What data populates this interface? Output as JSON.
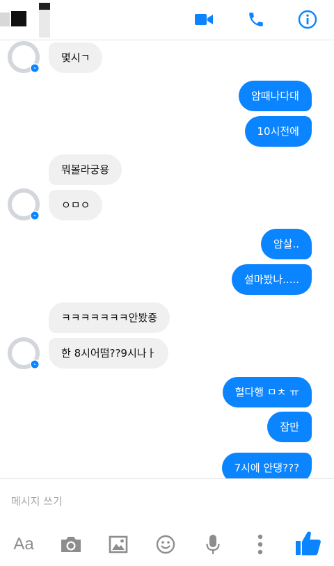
{
  "messages": [
    {
      "dir": "in",
      "text": "몇시ㄱ"
    },
    {
      "dir": "out",
      "text": "암때나다대"
    },
    {
      "dir": "out",
      "text": "10시전에"
    },
    {
      "dir": "in",
      "text": "뭐볼라궁용"
    },
    {
      "dir": "in",
      "text": "ㅇㅁㅇ"
    },
    {
      "dir": "out",
      "text": "암살.."
    },
    {
      "dir": "out",
      "text": "설마봤나....."
    },
    {
      "dir": "in",
      "text": "ㅋㅋㅋㅋㅋㅋㅋ안봤죵"
    },
    {
      "dir": "in",
      "text": "한 8시어떰??9시나ㅏ"
    },
    {
      "dir": "out",
      "text": "헐다행 ㅁㅊ ㅠ"
    },
    {
      "dir": "out",
      "text": "잠만"
    },
    {
      "dir": "out",
      "text": "7시에 안댕???"
    }
  ],
  "composer": {
    "placeholder": "메시지 쓰기",
    "font_button_label": "Aa"
  },
  "icons": {
    "header": [
      "video-camera-icon",
      "phone-icon",
      "info-icon"
    ],
    "toolbar": [
      "font-icon",
      "camera-icon",
      "gallery-icon",
      "emoji-icon",
      "microphone-icon",
      "more-icon",
      "like-icon"
    ]
  },
  "colors": {
    "accent": "#0a84ff",
    "incoming_bubble": "#f1f0f0",
    "toolbar_icon": "#8d8d8d"
  }
}
